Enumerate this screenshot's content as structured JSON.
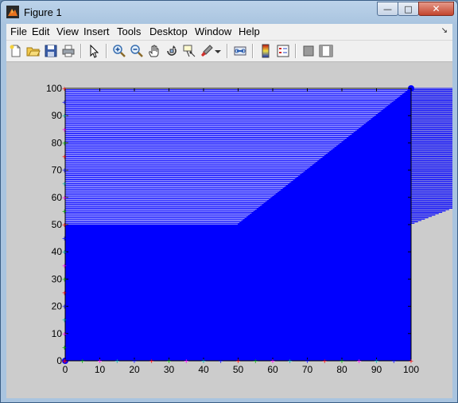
{
  "window": {
    "title": "Figure 1",
    "icon": "matlab-figure-icon",
    "controls": {
      "minimize": "—",
      "maximize": "□",
      "close": "✕"
    }
  },
  "menu": {
    "items": [
      "File",
      "Edit",
      "View",
      "Insert",
      "Tools",
      "Desktop",
      "Window",
      "Help"
    ],
    "overflow": "↘"
  },
  "toolbar": {
    "tools": [
      "new-figure-icon",
      "open-file-icon",
      "save-icon",
      "print-icon",
      "edit-plot-arrow-icon",
      "zoom-in-icon",
      "zoom-out-icon",
      "pan-hand-icon",
      "rotate-3d-icon",
      "data-cursor-icon",
      "brush-icon",
      "brush-dropdown-icon",
      "link-plot-icon",
      "colorbar-icon",
      "legend-icon",
      "hide-plot-tools-icon",
      "show-plot-tools-icon"
    ]
  },
  "colors": {
    "plot_fill": "#0000ff",
    "figure_background": "#cccccc",
    "axes_background": "#ffffff"
  },
  "chart_data": {
    "type": "line",
    "title": "",
    "xlabel": "",
    "ylabel": "",
    "xlim": [
      0,
      100
    ],
    "ylim": [
      0,
      100
    ],
    "xticks": [
      0,
      10,
      20,
      30,
      40,
      50,
      60,
      70,
      80,
      90,
      100
    ],
    "yticks": [
      0,
      10,
      20,
      30,
      40,
      50,
      60,
      70,
      80,
      90,
      100
    ],
    "grid": false,
    "legend": "none",
    "series": [
      {
        "shape": "dense horizontal lines from x=0 to x=max(y,50)*2 for y in 0..100, fully solid below y=50",
        "color": "#0000ff",
        "x": [
          0,
          100,
          0,
          100,
          0,
          0,
          50,
          0,
          100
        ],
        "y": [
          0,
          0,
          0,
          100,
          0,
          50,
          50,
          100,
          100
        ]
      }
    ]
  }
}
